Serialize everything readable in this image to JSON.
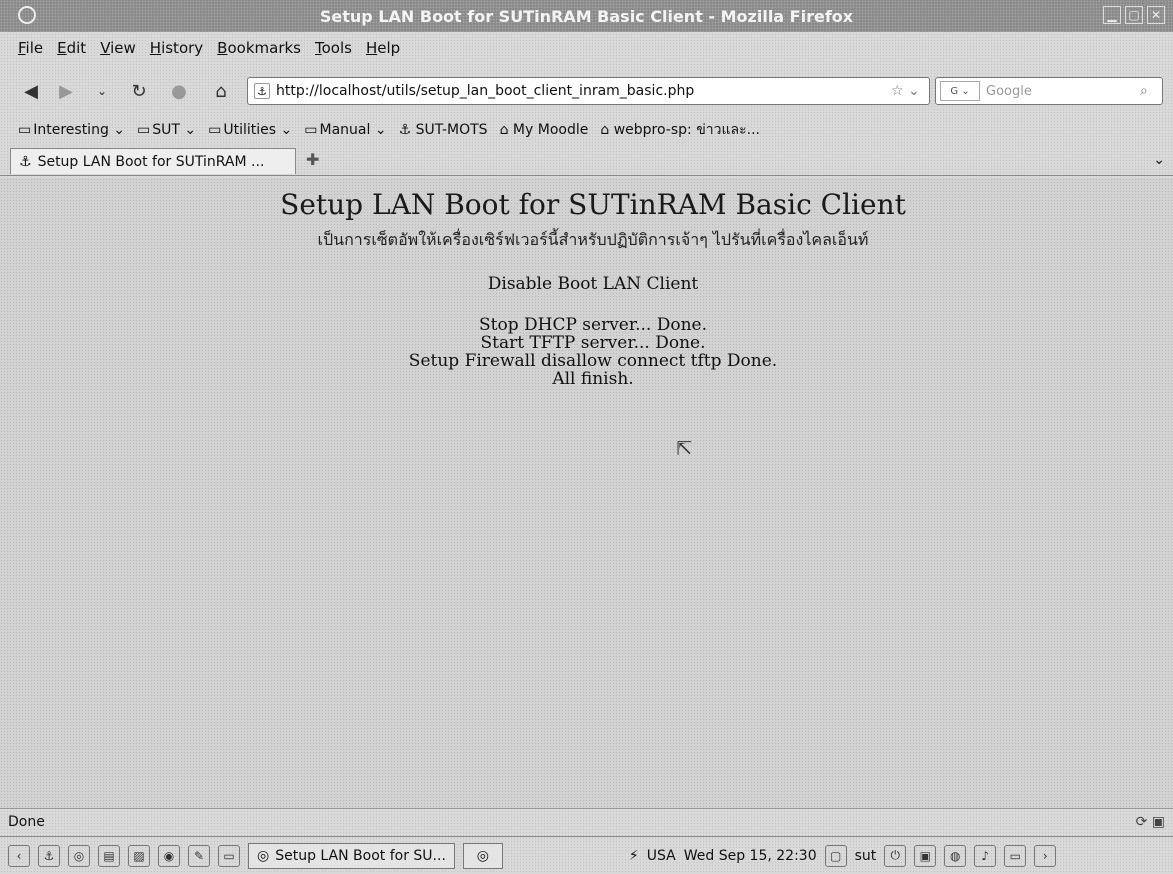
{
  "window": {
    "title": "Setup LAN Boot for SUTinRAM Basic Client - Mozilla Firefox",
    "controls": [
      "▁",
      "▢",
      "✕"
    ]
  },
  "menu": {
    "items": [
      "File",
      "Edit",
      "View",
      "History",
      "Bookmarks",
      "Tools",
      "Help"
    ]
  },
  "navigation": {
    "url": "http://localhost/utils/setup_lan_boot_client_inram_basic.php",
    "search_placeholder": "Google",
    "search_engine_icon": "google-search-engine-icon"
  },
  "bookmarks": {
    "items": [
      {
        "label": "Interesting",
        "type": "folder"
      },
      {
        "label": "SUT",
        "type": "folder"
      },
      {
        "label": "Utilities",
        "type": "folder"
      },
      {
        "label": "Manual",
        "type": "folder"
      },
      {
        "label": "SUT-MOTS",
        "type": "link"
      },
      {
        "label": "My Moodle",
        "type": "link"
      },
      {
        "label": "webpro-sp: ข่าวและ...",
        "type": "link"
      }
    ]
  },
  "tabs": {
    "active_label": "Setup LAN Boot for SUTinRAM ..."
  },
  "page": {
    "title": "Setup LAN Boot for SUTinRAM Basic Client",
    "subtitle": "เป็นการเซ็ตอัพให้เครื่องเซิร์ฟเวอร์นี้สำหรับปฏิบัติการเจ้าๆ ไปรันที่เครื่องไคลเอ็นท์",
    "heading": "Disable Boot LAN Client",
    "status_lines": [
      "Stop DHCP server... Done.",
      "Start TFTP server... Done.",
      "Setup Firewall disallow connect tftp Done.",
      "All finish."
    ]
  },
  "statusbar": {
    "text": "Done"
  },
  "taskbar": {
    "task_label": "Setup LAN Boot for SU...",
    "keyboard_layout": "USA",
    "clock": "Wed Sep 15, 22:30",
    "user": "sut"
  }
}
